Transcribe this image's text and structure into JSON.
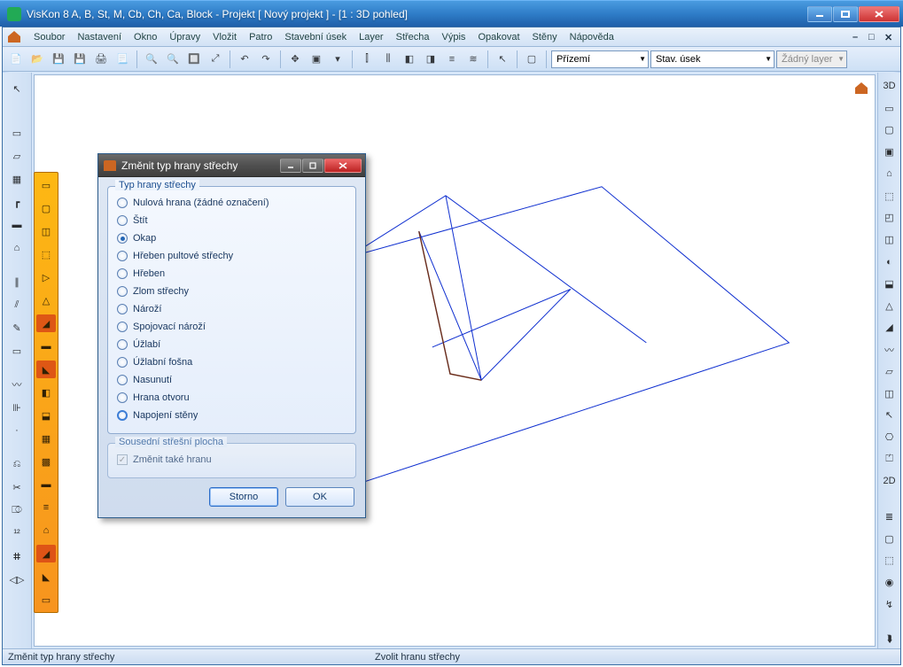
{
  "window": {
    "title": "VisKon 8 A, B, St, M, Cb, Ch, Ca, Block - Projekt [ Nový projekt ]  - [1 : 3D pohled]"
  },
  "menu": {
    "items": [
      "Soubor",
      "Nastavení",
      "Okno",
      "Úpravy",
      "Vložit",
      "Patro",
      "Stavební úsek",
      "Layer",
      "Střecha",
      "Výpis",
      "Opakovat",
      "Stěny",
      "Nápověda"
    ]
  },
  "dropdowns": {
    "floor": "Přízemí",
    "section": "Stav. úsek",
    "layer": "Žádný layer"
  },
  "dialog": {
    "title": "Změnit typ hrany střechy",
    "group1_title": "Typ hrany střechy",
    "options": [
      "Nulová hrana (žádné označení)",
      "Štít",
      "Okap",
      "Hřeben pultové střechy",
      "Hřeben",
      "Zlom střechy",
      "Nároží",
      "Spojovací nároží",
      "Úžlabí",
      "Úžlabní fošna",
      "Nasunutí",
      "Hrana otvoru",
      "Napojení stěny"
    ],
    "selected_index": 2,
    "group2_title": "Sousední střešní plocha",
    "checkbox_label": "Změnit také hranu",
    "checkbox_checked": true,
    "btn_cancel": "Storno",
    "btn_ok": "OK"
  },
  "status": {
    "left": "Změnit typ hrany střechy",
    "center": "Zvolit hranu střechy"
  }
}
